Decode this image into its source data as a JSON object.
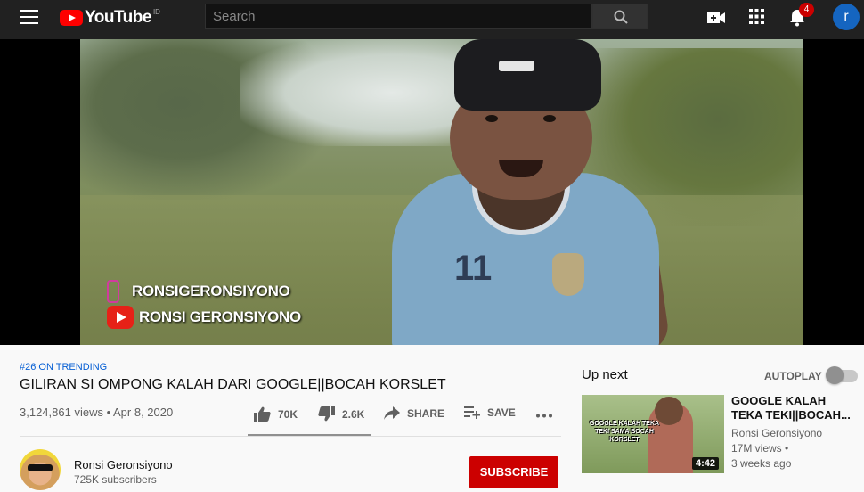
{
  "header": {
    "logo_text": "YouTube",
    "logo_region": "ID",
    "search_placeholder": "Search",
    "notification_count": "4",
    "avatar_letter": "r"
  },
  "player": {
    "watermark_instagram": "RONSIGERONSIYONO",
    "watermark_youtube": "RONSI GERONSIYONO",
    "jersey_number": "11"
  },
  "video": {
    "trending": "#26 ON TRENDING",
    "title": "GILIRAN SI OMPONG KALAH DARI GOOGLE||BOCAH KORSLET",
    "views_date": "3,124,861 views • Apr 8, 2020",
    "likes": "70K",
    "dislikes": "2.6K",
    "share_label": "SHARE",
    "save_label": "SAVE",
    "like_ratio": 0.964
  },
  "channel": {
    "name": "Ronsi Geronsiyono",
    "subscribers": "725K subscribers",
    "subscribe_label": "SUBSCRIBE"
  },
  "up_next": {
    "heading": "Up next",
    "autoplay_label": "AUTOPLAY",
    "autoplay_on": false,
    "item": {
      "thumb_text": "GOOGLE KALAH TEKA TEKI SAMA BOCAH KORSLET",
      "duration": "4:42",
      "title": "GOOGLE KALAH TEKA TEKI||BOCAH...",
      "channel": "Ronsi Geronsiyono",
      "views": "17M views •",
      "age": "3 weeks ago"
    }
  },
  "colors": {
    "topbar": "#212121",
    "brand_red": "#ff0000",
    "subscribe_red": "#cc0000",
    "link_blue": "#065fd4",
    "avatar_blue": "#1565c0"
  },
  "icons": [
    "menu-icon",
    "youtube-logo-icon",
    "search-icon",
    "create-video-icon",
    "apps-grid-icon",
    "bell-icon",
    "thumbs-up-icon",
    "thumbs-down-icon",
    "share-arrow-icon",
    "add-to-playlist-icon",
    "more-options-icon"
  ]
}
